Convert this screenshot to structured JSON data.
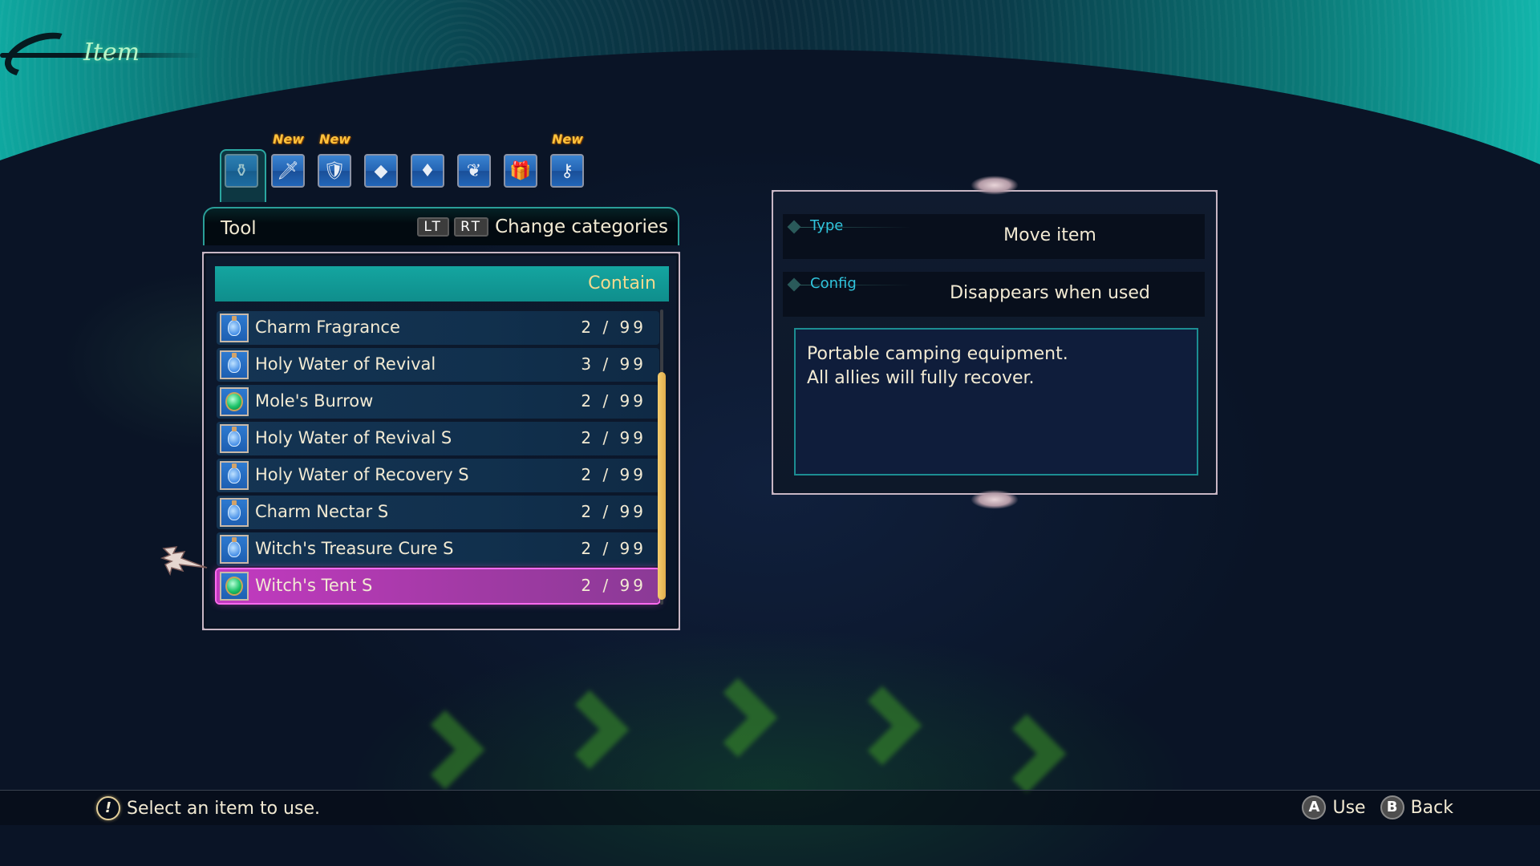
{
  "screen": {
    "title": "Item"
  },
  "categories": [
    {
      "name": "tool",
      "icon": "potion-bag-icon",
      "glyph": "⚱",
      "new": false,
      "active": true
    },
    {
      "name": "weapon",
      "icon": "sword-icon",
      "glyph": "🗡",
      "new": true,
      "active": false
    },
    {
      "name": "armor",
      "icon": "armor-icon",
      "glyph": "🛡",
      "new": true,
      "active": false
    },
    {
      "name": "accessory",
      "icon": "pendant-icon",
      "glyph": "◆",
      "new": false,
      "active": false
    },
    {
      "name": "crystal",
      "icon": "crystal-icon",
      "glyph": "♦",
      "new": false,
      "active": false
    },
    {
      "name": "material",
      "icon": "material-icon",
      "glyph": "❦",
      "new": false,
      "active": false
    },
    {
      "name": "gift",
      "icon": "gift-box-icon",
      "glyph": "🎁",
      "new": false,
      "active": false
    },
    {
      "name": "key-item",
      "icon": "key-icon",
      "glyph": "⚷",
      "new": true,
      "active": false
    }
  ],
  "new_badge_label": "New",
  "list_header": {
    "category": "Tool",
    "key_lt": "LT",
    "key_rt": "RT",
    "hint": "Change categories"
  },
  "list": {
    "column_header": "Contain",
    "items": [
      {
        "name": "Charm Fragrance",
        "count": "2 / 99",
        "icon": "potion",
        "selected": false
      },
      {
        "name": "Holy Water of Revival",
        "count": "3 / 99",
        "icon": "potion",
        "selected": false
      },
      {
        "name": "Mole's Burrow",
        "count": "2 / 99",
        "icon": "gem",
        "selected": false
      },
      {
        "name": "Holy Water of Revival S",
        "count": "2 / 99",
        "icon": "potion",
        "selected": false
      },
      {
        "name": "Holy Water of Recovery S",
        "count": "2 / 99",
        "icon": "potion",
        "selected": false
      },
      {
        "name": "Charm Nectar S",
        "count": "2 / 99",
        "icon": "potion",
        "selected": false
      },
      {
        "name": "Witch's Treasure Cure S",
        "count": "2 / 99",
        "icon": "potion",
        "selected": false
      },
      {
        "name": "Witch's Tent S",
        "count": "2 / 99",
        "icon": "gem",
        "selected": true
      }
    ],
    "scroll_position": 0.25
  },
  "detail": {
    "type_label": "Type",
    "type_value": "Move item",
    "config_label": "Config",
    "config_value": "Disappears when used",
    "description_line1": "Portable camping equipment.",
    "description_line2": "All allies will fully recover."
  },
  "footer": {
    "help_text": "Select an item to use.",
    "button_a": "A",
    "button_a_label": "Use",
    "button_b": "B",
    "button_b_label": "Back"
  }
}
